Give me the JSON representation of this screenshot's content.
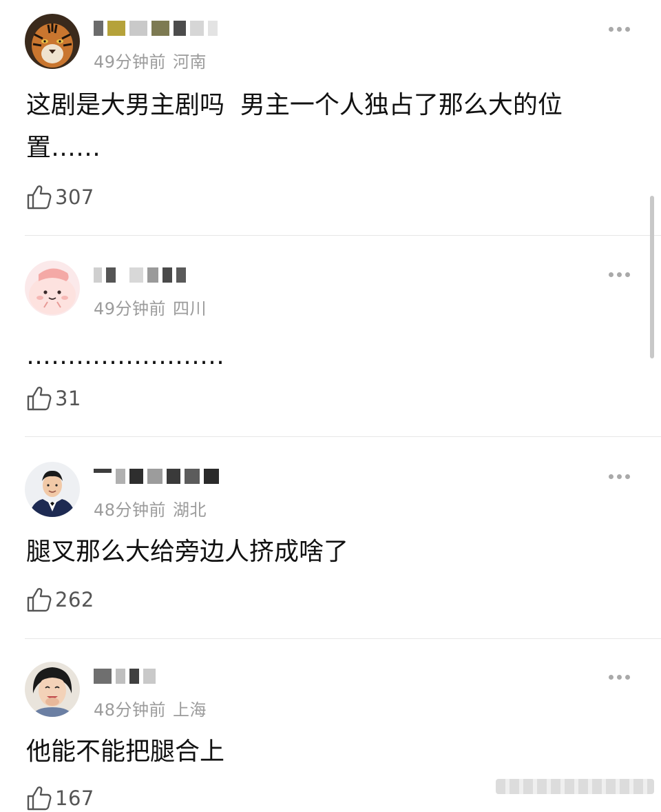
{
  "comments": [
    {
      "username_blocks": [
        "#6b6b6b",
        "#b5a23a",
        "#c9c9c9",
        "#7d7a52",
        "#4c4c4c",
        "#d6d6d6",
        "#e3e3e3"
      ],
      "time": "49分钟前",
      "location": "河南",
      "text": "这剧是大男主剧吗  男主一个人独占了那么大的位置……",
      "likes": "307",
      "avatar": "tiger-avatar"
    },
    {
      "username_blocks": [
        "#cfcfcf",
        "#555555",
        "#d8d8d8",
        "#9a9a9a",
        "#4a4a4a",
        "#5a5a5a"
      ],
      "time": "49分钟前",
      "location": "四川",
      "text": "……………………",
      "likes": "31",
      "avatar": "pink-cartoon-avatar"
    },
    {
      "username_blocks": [
        "#3d3d3d",
        "#b0b0b0",
        "#2e2e2e",
        "#9c9c9c",
        "#3a3a3a",
        "#5c5c5c",
        "#2a2a2a"
      ],
      "time": "48分钟前",
      "location": "湖北",
      "text": "腿叉那么大给旁边人挤成啥了",
      "likes": "262",
      "avatar": "suit-man-avatar"
    },
    {
      "username_blocks": [
        "#6f6f6f",
        "#bfbfbf",
        "#404040",
        "#c9c9c9"
      ],
      "time": "48分钟前",
      "location": "上海",
      "text": "他能不能把腿合上",
      "likes": "167",
      "avatar": "smiling-woman-avatar"
    }
  ],
  "icons": {
    "like": "thumbs-up-icon",
    "more": "more-dots-icon"
  },
  "colors": {
    "meta": "#9b9b9b",
    "text": "#111111",
    "like_count": "#555555",
    "divider": "#e6e6e6"
  }
}
